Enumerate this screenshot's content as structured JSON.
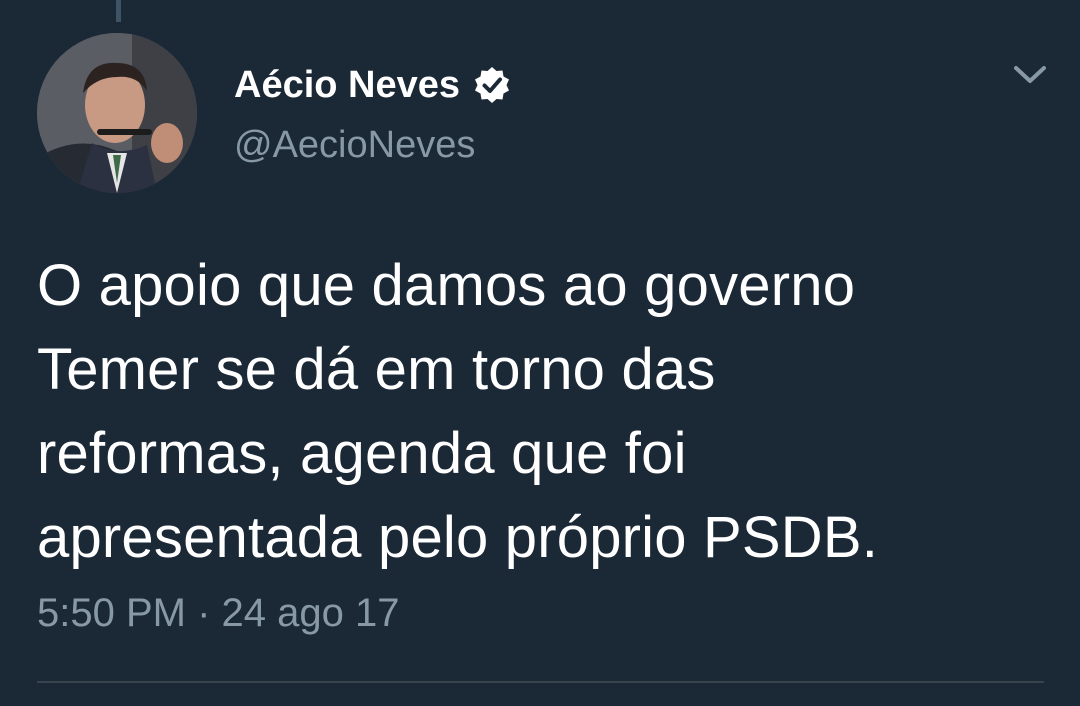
{
  "tweet": {
    "author_name": "Aécio Neves",
    "author_handle": "@AecioNeves",
    "verified": true,
    "text": "O apoio que damos ao governo\nTemer se dá em torno das\nreformas, agenda que foi\napresentada pelo próprio PSDB.",
    "time": "5:50 PM",
    "separator": "·",
    "date": "24 ago 17"
  },
  "theme": {
    "background": "#1b2836",
    "primary_text": "#ffffff",
    "secondary_text": "#8899a6",
    "divider": "#38444d"
  },
  "icons": {
    "verified": "verified-badge-icon",
    "menu": "chevron-down-icon"
  }
}
